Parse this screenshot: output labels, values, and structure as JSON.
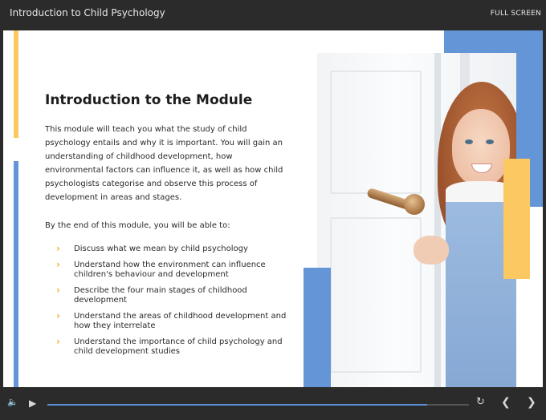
{
  "header": {
    "title": "Introduction to Child Psychology",
    "fullscreen_label": "FULL SCREEN"
  },
  "slide": {
    "heading": "Introduction to the Module",
    "intro": "This module will teach you what the study of child psychology entails and why it is important. You will gain an understanding of childhood development, how environmental factors can influence it, as well as how child psychologists categorise and observe this process of development in areas and stages.",
    "lead": "By the end of this module, you will be able to:",
    "bullet_icon": "chevron-right-icon",
    "objectives": [
      "Discuss what we mean by child psychology",
      "Understand how the environment can influence children's behaviour and development",
      "Describe the four main stages of childhood development",
      "Understand the areas of childhood development and how they interrelate",
      "Understand the importance of child psychology and child development studies"
    ],
    "colors": {
      "accent_yellow": "#fbc862",
      "accent_blue": "#6495d6"
    }
  },
  "player": {
    "progress_fraction": 0.9,
    "icons": {
      "volume": "volume-icon",
      "play": "play-icon",
      "replay": "replay-icon",
      "prev": "chevron-left-icon",
      "next": "chevron-right-icon"
    },
    "colors": {
      "progress": "#5b90d8"
    }
  }
}
